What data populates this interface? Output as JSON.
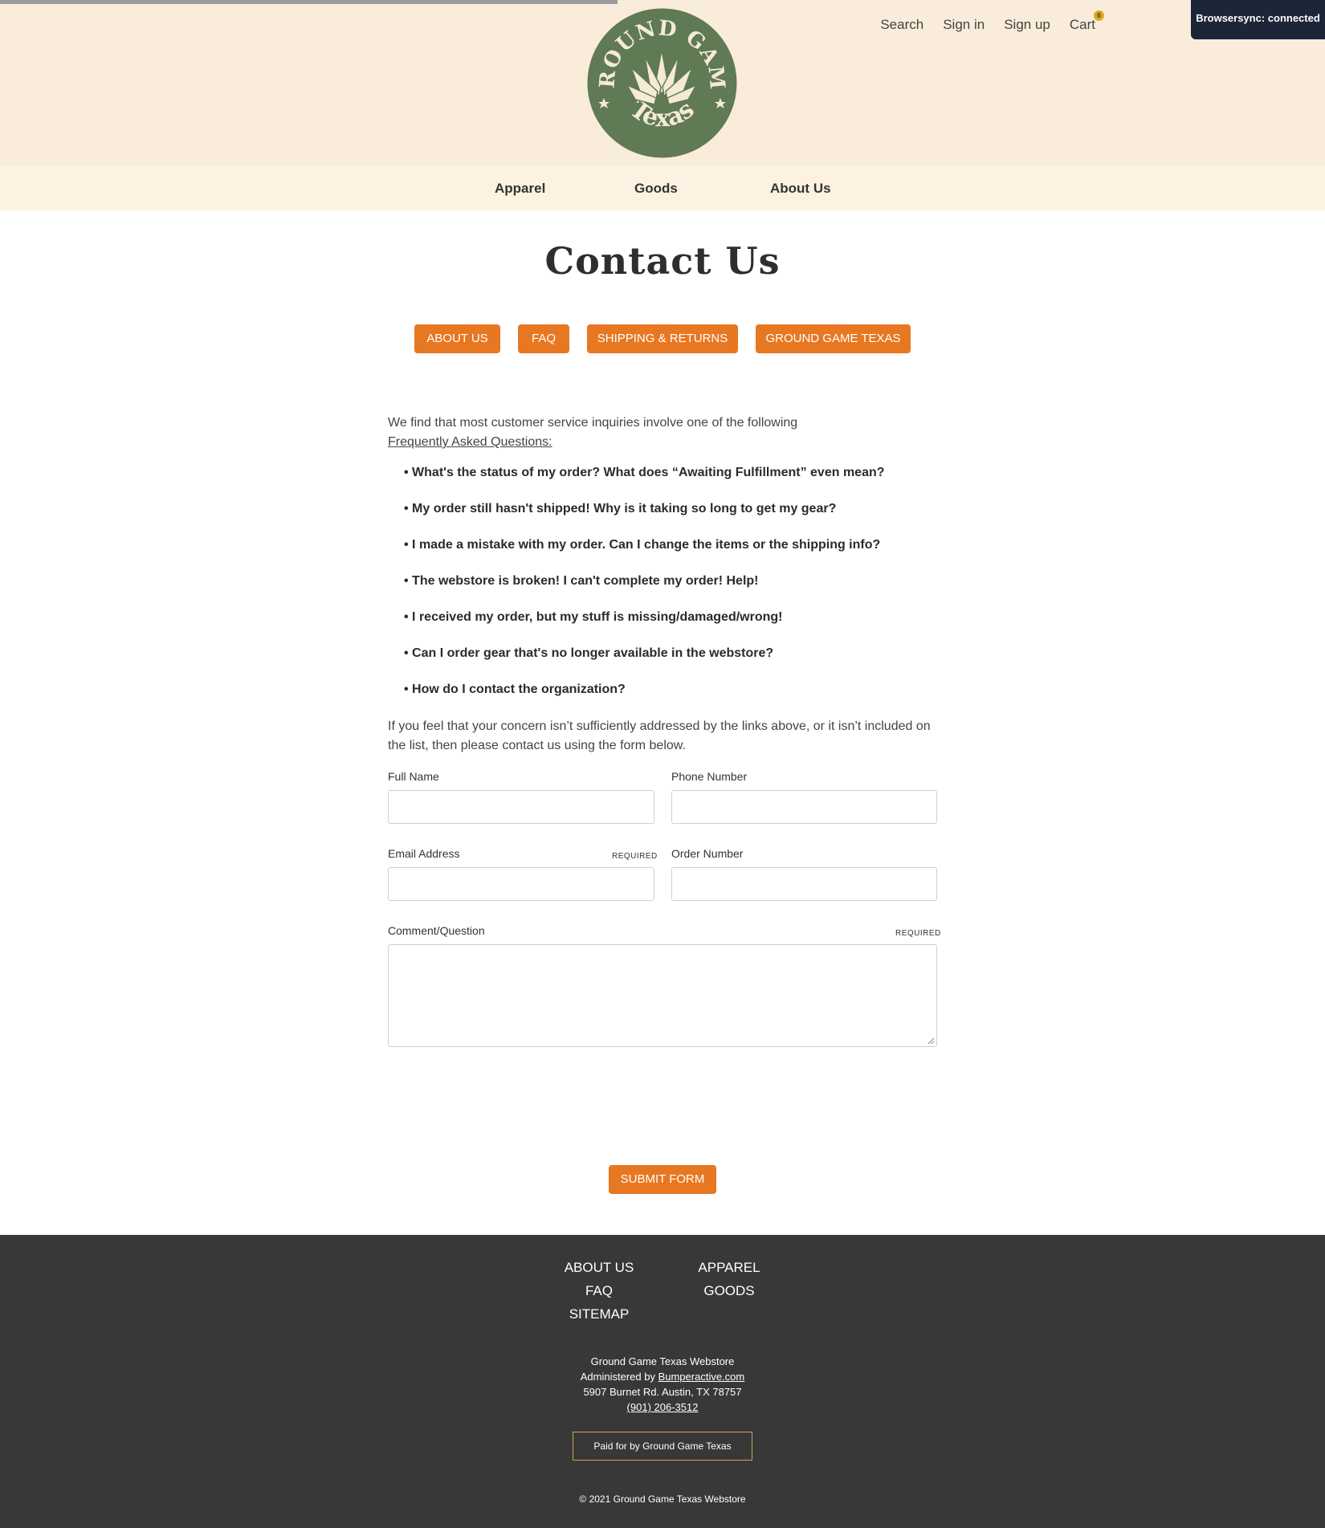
{
  "colors": {
    "accent": "#e87722",
    "header_bg": "#f9ecda",
    "nav_bg": "#fdf2e1",
    "footer_bg": "#383838",
    "logo_green": "#5f7a55",
    "logo_cream": "#f5ead6"
  },
  "logo": {
    "text_top": "GROUND GAME",
    "text_bottom": "Texas",
    "icon": "agave-plant-icon"
  },
  "utility_nav": {
    "search": "Search",
    "sign_in": "Sign in",
    "sign_up": "Sign up",
    "cart": "Cart",
    "cart_count": "0"
  },
  "browsersync": "Browsersync: connected",
  "main_nav": {
    "apparel": "Apparel",
    "goods": "Goods",
    "about": "About Us"
  },
  "page_title": "Contact Us",
  "pills": {
    "about": "ABOUT US",
    "faq": "FAQ",
    "shipping": "SHIPPING & RETURNS",
    "ggt": "GROUND GAME TEXAS"
  },
  "intro": {
    "text": "We find that most customer service inquiries involve one of the following",
    "link": "Frequently Asked Questions:"
  },
  "faqs": [
    "• What's the status of my order? What does “Awaiting Fulfillment” even mean?",
    "• My order still hasn't shipped! Why is it taking so long to get my gear?",
    "• I made a mistake with my order. Can I change the items or the shipping info?",
    "• The webstore is broken! I can't complete my order! Help!",
    "• I received my order, but my stuff is missing/damaged/wrong!",
    "• Can I order gear that's no longer available in the webstore?",
    "• How do I contact the organization?"
  ],
  "concern_text": "If you feel that your concern isn’t sufficiently addressed by the links above, or it isn’t included on the list, then please contact us using the form below.",
  "form": {
    "full_name": {
      "label": "Full Name",
      "value": ""
    },
    "phone": {
      "label": "Phone Number",
      "value": ""
    },
    "email": {
      "label": "Email Address",
      "required": "REQUIRED",
      "value": ""
    },
    "order": {
      "label": "Order Number",
      "value": ""
    },
    "comment": {
      "label": "Comment/Question",
      "required": "REQUIRED",
      "value": ""
    },
    "submit": "SUBMIT FORM"
  },
  "footer": {
    "links_left": [
      "ABOUT US",
      "FAQ",
      "SITEMAP"
    ],
    "links_right": [
      "APPAREL",
      "GOODS"
    ],
    "store": "Ground Game Texas Webstore",
    "administered_prefix": "Administered by ",
    "administered_link": "Bumperactive.com",
    "address": "5907 Burnet Rd. Austin, TX 78757",
    "phone": "(901) 206-3512",
    "paid_for": "Paid for by Ground Game Texas",
    "copyright": "© 2021 Ground Game Texas Webstore"
  }
}
